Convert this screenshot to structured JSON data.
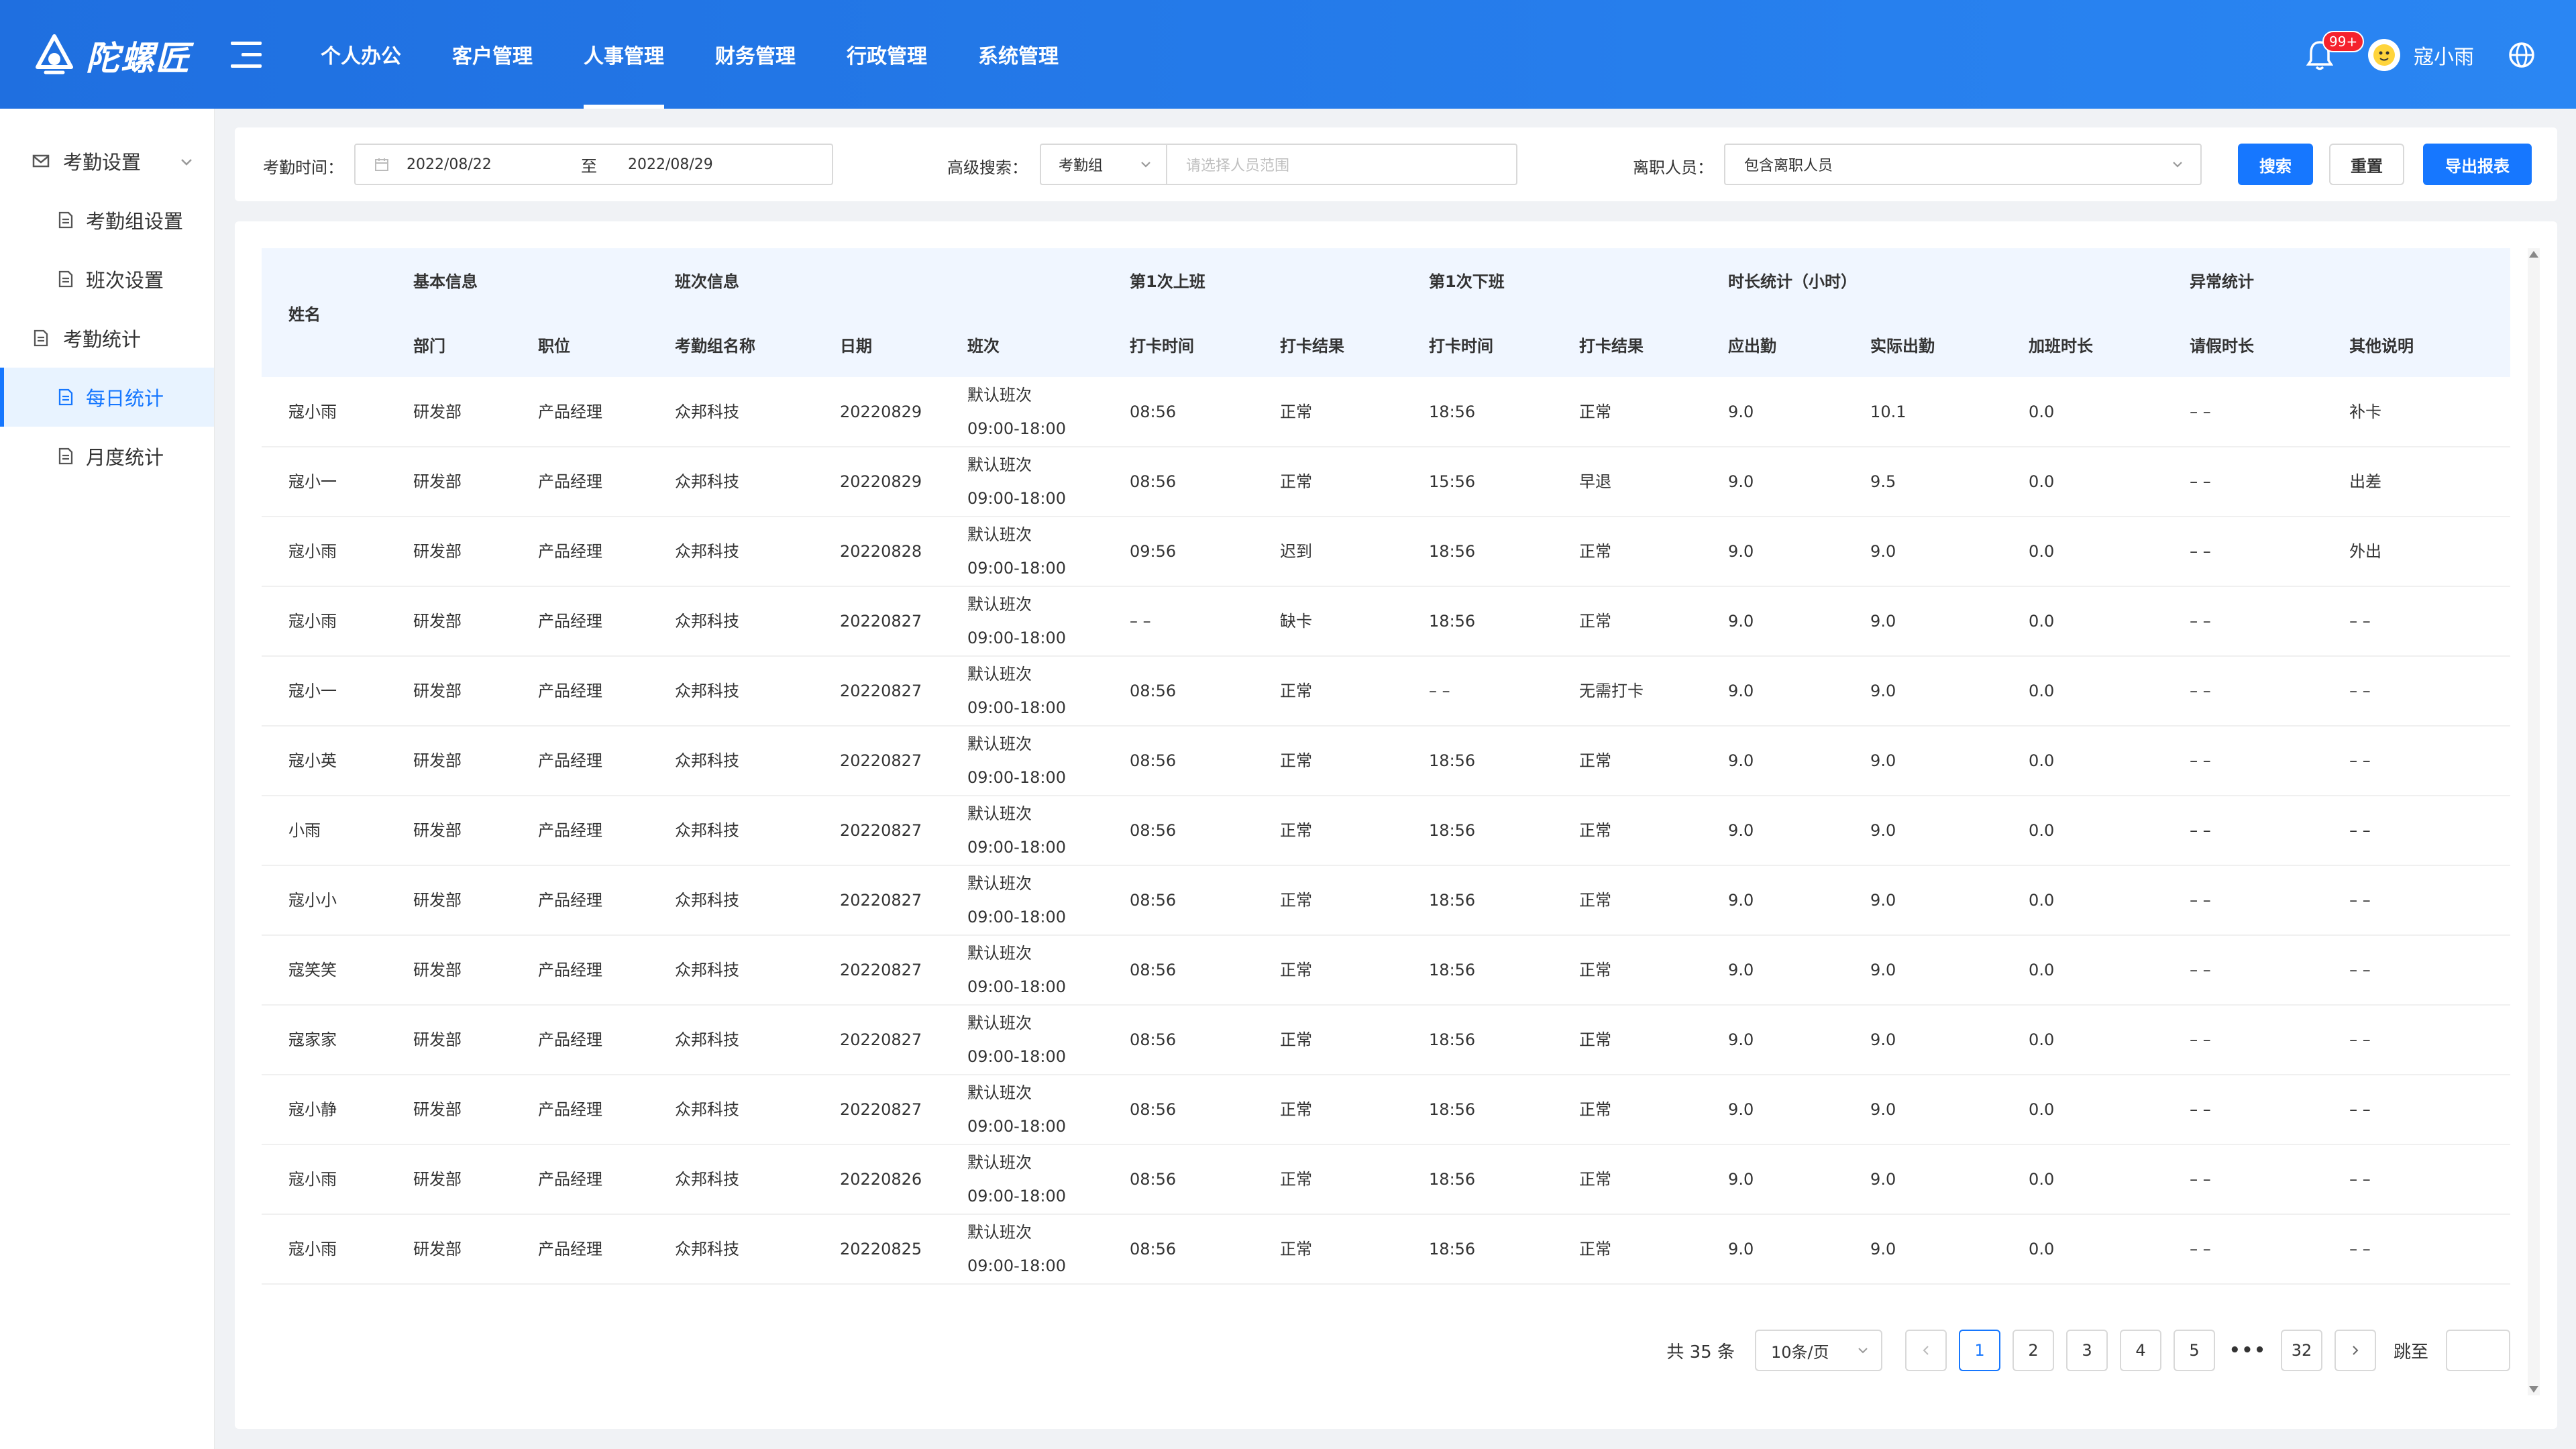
{
  "app": {
    "logo_text": "陀螺匠"
  },
  "topnav": {
    "items": [
      {
        "label": "个人办公"
      },
      {
        "label": "客户管理"
      },
      {
        "label": "人事管理"
      },
      {
        "label": "财务管理"
      },
      {
        "label": "行政管理"
      },
      {
        "label": "系统管理"
      }
    ],
    "active_index": 2
  },
  "header": {
    "notification_badge": "99+",
    "username": "寇小雨"
  },
  "sidebar": {
    "group1": "考勤设置",
    "group1_items": [
      "考勤组设置",
      "班次设置"
    ],
    "group2": "考勤统计",
    "group2_items": [
      "每日统计",
      "月度统计"
    ],
    "active_item": "每日统计"
  },
  "filter": {
    "time_label": "考勤时间：",
    "start_date": "2022/08/22",
    "to_label": "至",
    "end_date": "2022/08/29",
    "adv_label": "高级搜索：",
    "adv_select": "考勤组",
    "adv_placeholder": "请选择人员范围",
    "resigned_label": "离职人员：",
    "resigned_value": "包含离职人员",
    "search_btn": "搜索",
    "reset_btn": "重置",
    "export_btn": "导出报表"
  },
  "table": {
    "group_headers": {
      "name": "姓名",
      "basic": "基本信息",
      "shift": "班次信息",
      "checkin1": "第1次上班",
      "checkout1": "第1次下班",
      "duration": "时长统计（小时）",
      "abnormal": "异常统计"
    },
    "sub_headers": {
      "dept": "部门",
      "position": "职位",
      "group_name": "考勤组名称",
      "date": "日期",
      "shift": "班次",
      "in_time": "打卡时间",
      "in_result": "打卡结果",
      "out_time": "打卡时间",
      "out_result": "打卡结果",
      "should": "应出勤",
      "actual": "实际出勤",
      "overtime": "加班时长",
      "leave": "请假时长",
      "note": "其他说明"
    },
    "rows": [
      {
        "name": "寇小雨",
        "dept": "研发部",
        "position": "产品经理",
        "group": "众邦科技",
        "date": "20220829",
        "shift_name": "默认班次",
        "shift_time": "09:00-18:00",
        "in_time": "08:56",
        "in_result": "正常",
        "in_red": false,
        "out_time": "18:56",
        "out_result": "正常",
        "out_red": false,
        "should": "9.0",
        "actual": "10.1",
        "overtime": "0.0",
        "leave": "– –",
        "note": "补卡"
      },
      {
        "name": "寇小一",
        "dept": "研发部",
        "position": "产品经理",
        "group": "众邦科技",
        "date": "20220829",
        "shift_name": "默认班次",
        "shift_time": "09:00-18:00",
        "in_time": "08:56",
        "in_result": "正常",
        "in_red": false,
        "out_time": "15:56",
        "out_result": "早退",
        "out_red": true,
        "should": "9.0",
        "actual": "9.5",
        "overtime": "0.0",
        "leave": "– –",
        "note": "出差"
      },
      {
        "name": "寇小雨",
        "dept": "研发部",
        "position": "产品经理",
        "group": "众邦科技",
        "date": "20220828",
        "shift_name": "默认班次",
        "shift_time": "09:00-18:00",
        "in_time": "09:56",
        "in_result": "迟到",
        "in_red": true,
        "out_time": "18:56",
        "out_result": "正常",
        "out_red": false,
        "should": "9.0",
        "actual": "9.0",
        "overtime": "0.0",
        "leave": "– –",
        "note": "外出"
      },
      {
        "name": "寇小雨",
        "dept": "研发部",
        "position": "产品经理",
        "group": "众邦科技",
        "date": "20220827",
        "shift_name": "默认班次",
        "shift_time": "09:00-18:00",
        "in_time": "– –",
        "in_result": "缺卡",
        "in_red": true,
        "out_time": "18:56",
        "out_result": "正常",
        "out_red": false,
        "should": "9.0",
        "actual": "9.0",
        "overtime": "0.0",
        "leave": "– –",
        "note": "– –"
      },
      {
        "name": "寇小一",
        "dept": "研发部",
        "position": "产品经理",
        "group": "众邦科技",
        "date": "20220827",
        "shift_name": "默认班次",
        "shift_time": "09:00-18:00",
        "in_time": "08:56",
        "in_result": "正常",
        "in_red": false,
        "out_time": "– –",
        "out_result": "无需打卡",
        "out_red": false,
        "should": "9.0",
        "actual": "9.0",
        "overtime": "0.0",
        "leave": "– –",
        "note": "– –"
      },
      {
        "name": "寇小英",
        "dept": "研发部",
        "position": "产品经理",
        "group": "众邦科技",
        "date": "20220827",
        "shift_name": "默认班次",
        "shift_time": "09:00-18:00",
        "in_time": "08:56",
        "in_result": "正常",
        "in_red": false,
        "out_time": "18:56",
        "out_result": "正常",
        "out_red": false,
        "should": "9.0",
        "actual": "9.0",
        "overtime": "0.0",
        "leave": "– –",
        "note": "– –"
      },
      {
        "name": "小雨",
        "dept": "研发部",
        "position": "产品经理",
        "group": "众邦科技",
        "date": "20220827",
        "shift_name": "默认班次",
        "shift_time": "09:00-18:00",
        "in_time": "08:56",
        "in_result": "正常",
        "in_red": false,
        "out_time": "18:56",
        "out_result": "正常",
        "out_red": false,
        "should": "9.0",
        "actual": "9.0",
        "overtime": "0.0",
        "leave": "– –",
        "note": "– –"
      },
      {
        "name": "寇小小",
        "dept": "研发部",
        "position": "产品经理",
        "group": "众邦科技",
        "date": "20220827",
        "shift_name": "默认班次",
        "shift_time": "09:00-18:00",
        "in_time": "08:56",
        "in_result": "正常",
        "in_red": false,
        "out_time": "18:56",
        "out_result": "正常",
        "out_red": false,
        "should": "9.0",
        "actual": "9.0",
        "overtime": "0.0",
        "leave": "– –",
        "note": "– –"
      },
      {
        "name": "寇笑笑",
        "dept": "研发部",
        "position": "产品经理",
        "group": "众邦科技",
        "date": "20220827",
        "shift_name": "默认班次",
        "shift_time": "09:00-18:00",
        "in_time": "08:56",
        "in_result": "正常",
        "in_red": false,
        "out_time": "18:56",
        "out_result": "正常",
        "out_red": false,
        "should": "9.0",
        "actual": "9.0",
        "overtime": "0.0",
        "leave": "– –",
        "note": "– –"
      },
      {
        "name": "寇家家",
        "dept": "研发部",
        "position": "产品经理",
        "group": "众邦科技",
        "date": "20220827",
        "shift_name": "默认班次",
        "shift_time": "09:00-18:00",
        "in_time": "08:56",
        "in_result": "正常",
        "in_red": false,
        "out_time": "18:56",
        "out_result": "正常",
        "out_red": false,
        "should": "9.0",
        "actual": "9.0",
        "overtime": "0.0",
        "leave": "– –",
        "note": "– –"
      },
      {
        "name": "寇小静",
        "dept": "研发部",
        "position": "产品经理",
        "group": "众邦科技",
        "date": "20220827",
        "shift_name": "默认班次",
        "shift_time": "09:00-18:00",
        "in_time": "08:56",
        "in_result": "正常",
        "in_red": false,
        "out_time": "18:56",
        "out_result": "正常",
        "out_red": false,
        "should": "9.0",
        "actual": "9.0",
        "overtime": "0.0",
        "leave": "– –",
        "note": "– –"
      },
      {
        "name": "寇小雨",
        "dept": "研发部",
        "position": "产品经理",
        "group": "众邦科技",
        "date": "20220826",
        "shift_name": "默认班次",
        "shift_time": "09:00-18:00",
        "in_time": "08:56",
        "in_result": "正常",
        "in_red": false,
        "out_time": "18:56",
        "out_result": "正常",
        "out_red": false,
        "should": "9.0",
        "actual": "9.0",
        "overtime": "0.0",
        "leave": "– –",
        "note": "– –"
      },
      {
        "name": "寇小雨",
        "dept": "研发部",
        "position": "产品经理",
        "group": "众邦科技",
        "date": "20220825",
        "shift_name": "默认班次",
        "shift_time": "09:00-18:00",
        "in_time": "08:56",
        "in_result": "正常",
        "in_red": false,
        "out_time": "18:56",
        "out_result": "正常",
        "out_red": false,
        "should": "9.0",
        "actual": "9.0",
        "overtime": "0.0",
        "leave": "– –",
        "note": "– –"
      }
    ]
  },
  "pagination": {
    "total": "共 35 条",
    "page_size": "10条/页",
    "pages": [
      "1",
      "2",
      "3",
      "4",
      "5"
    ],
    "ellipsis": "•••",
    "last_page": "32",
    "current": "1",
    "jump_label": "跳至"
  },
  "colors": {
    "primary": "#1677ff",
    "header_blue": "#2a86f3",
    "danger": "#f5222d"
  }
}
